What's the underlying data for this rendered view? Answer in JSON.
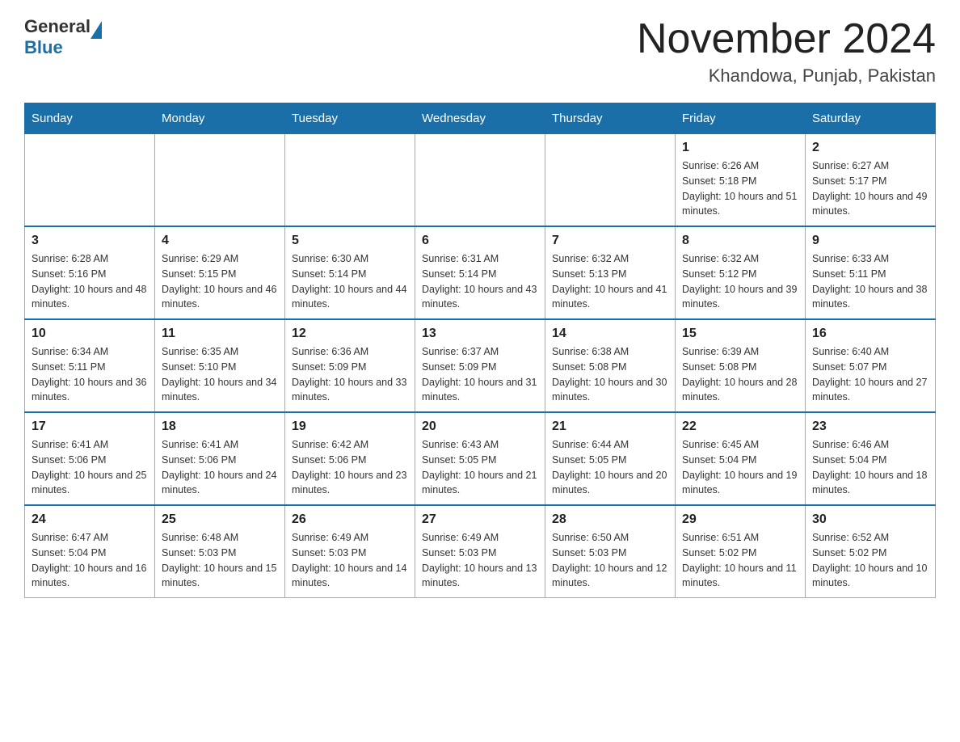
{
  "header": {
    "logo": {
      "text_general": "General",
      "text_blue": "Blue"
    },
    "title": "November 2024",
    "location": "Khandowa, Punjab, Pakistan"
  },
  "days_of_week": [
    "Sunday",
    "Monday",
    "Tuesday",
    "Wednesday",
    "Thursday",
    "Friday",
    "Saturday"
  ],
  "weeks": [
    [
      {
        "day": "",
        "info": ""
      },
      {
        "day": "",
        "info": ""
      },
      {
        "day": "",
        "info": ""
      },
      {
        "day": "",
        "info": ""
      },
      {
        "day": "",
        "info": ""
      },
      {
        "day": "1",
        "info": "Sunrise: 6:26 AM\nSunset: 5:18 PM\nDaylight: 10 hours and 51 minutes."
      },
      {
        "day": "2",
        "info": "Sunrise: 6:27 AM\nSunset: 5:17 PM\nDaylight: 10 hours and 49 minutes."
      }
    ],
    [
      {
        "day": "3",
        "info": "Sunrise: 6:28 AM\nSunset: 5:16 PM\nDaylight: 10 hours and 48 minutes."
      },
      {
        "day": "4",
        "info": "Sunrise: 6:29 AM\nSunset: 5:15 PM\nDaylight: 10 hours and 46 minutes."
      },
      {
        "day": "5",
        "info": "Sunrise: 6:30 AM\nSunset: 5:14 PM\nDaylight: 10 hours and 44 minutes."
      },
      {
        "day": "6",
        "info": "Sunrise: 6:31 AM\nSunset: 5:14 PM\nDaylight: 10 hours and 43 minutes."
      },
      {
        "day": "7",
        "info": "Sunrise: 6:32 AM\nSunset: 5:13 PM\nDaylight: 10 hours and 41 minutes."
      },
      {
        "day": "8",
        "info": "Sunrise: 6:32 AM\nSunset: 5:12 PM\nDaylight: 10 hours and 39 minutes."
      },
      {
        "day": "9",
        "info": "Sunrise: 6:33 AM\nSunset: 5:11 PM\nDaylight: 10 hours and 38 minutes."
      }
    ],
    [
      {
        "day": "10",
        "info": "Sunrise: 6:34 AM\nSunset: 5:11 PM\nDaylight: 10 hours and 36 minutes."
      },
      {
        "day": "11",
        "info": "Sunrise: 6:35 AM\nSunset: 5:10 PM\nDaylight: 10 hours and 34 minutes."
      },
      {
        "day": "12",
        "info": "Sunrise: 6:36 AM\nSunset: 5:09 PM\nDaylight: 10 hours and 33 minutes."
      },
      {
        "day": "13",
        "info": "Sunrise: 6:37 AM\nSunset: 5:09 PM\nDaylight: 10 hours and 31 minutes."
      },
      {
        "day": "14",
        "info": "Sunrise: 6:38 AM\nSunset: 5:08 PM\nDaylight: 10 hours and 30 minutes."
      },
      {
        "day": "15",
        "info": "Sunrise: 6:39 AM\nSunset: 5:08 PM\nDaylight: 10 hours and 28 minutes."
      },
      {
        "day": "16",
        "info": "Sunrise: 6:40 AM\nSunset: 5:07 PM\nDaylight: 10 hours and 27 minutes."
      }
    ],
    [
      {
        "day": "17",
        "info": "Sunrise: 6:41 AM\nSunset: 5:06 PM\nDaylight: 10 hours and 25 minutes."
      },
      {
        "day": "18",
        "info": "Sunrise: 6:41 AM\nSunset: 5:06 PM\nDaylight: 10 hours and 24 minutes."
      },
      {
        "day": "19",
        "info": "Sunrise: 6:42 AM\nSunset: 5:06 PM\nDaylight: 10 hours and 23 minutes."
      },
      {
        "day": "20",
        "info": "Sunrise: 6:43 AM\nSunset: 5:05 PM\nDaylight: 10 hours and 21 minutes."
      },
      {
        "day": "21",
        "info": "Sunrise: 6:44 AM\nSunset: 5:05 PM\nDaylight: 10 hours and 20 minutes."
      },
      {
        "day": "22",
        "info": "Sunrise: 6:45 AM\nSunset: 5:04 PM\nDaylight: 10 hours and 19 minutes."
      },
      {
        "day": "23",
        "info": "Sunrise: 6:46 AM\nSunset: 5:04 PM\nDaylight: 10 hours and 18 minutes."
      }
    ],
    [
      {
        "day": "24",
        "info": "Sunrise: 6:47 AM\nSunset: 5:04 PM\nDaylight: 10 hours and 16 minutes."
      },
      {
        "day": "25",
        "info": "Sunrise: 6:48 AM\nSunset: 5:03 PM\nDaylight: 10 hours and 15 minutes."
      },
      {
        "day": "26",
        "info": "Sunrise: 6:49 AM\nSunset: 5:03 PM\nDaylight: 10 hours and 14 minutes."
      },
      {
        "day": "27",
        "info": "Sunrise: 6:49 AM\nSunset: 5:03 PM\nDaylight: 10 hours and 13 minutes."
      },
      {
        "day": "28",
        "info": "Sunrise: 6:50 AM\nSunset: 5:03 PM\nDaylight: 10 hours and 12 minutes."
      },
      {
        "day": "29",
        "info": "Sunrise: 6:51 AM\nSunset: 5:02 PM\nDaylight: 10 hours and 11 minutes."
      },
      {
        "day": "30",
        "info": "Sunrise: 6:52 AM\nSunset: 5:02 PM\nDaylight: 10 hours and 10 minutes."
      }
    ]
  ]
}
